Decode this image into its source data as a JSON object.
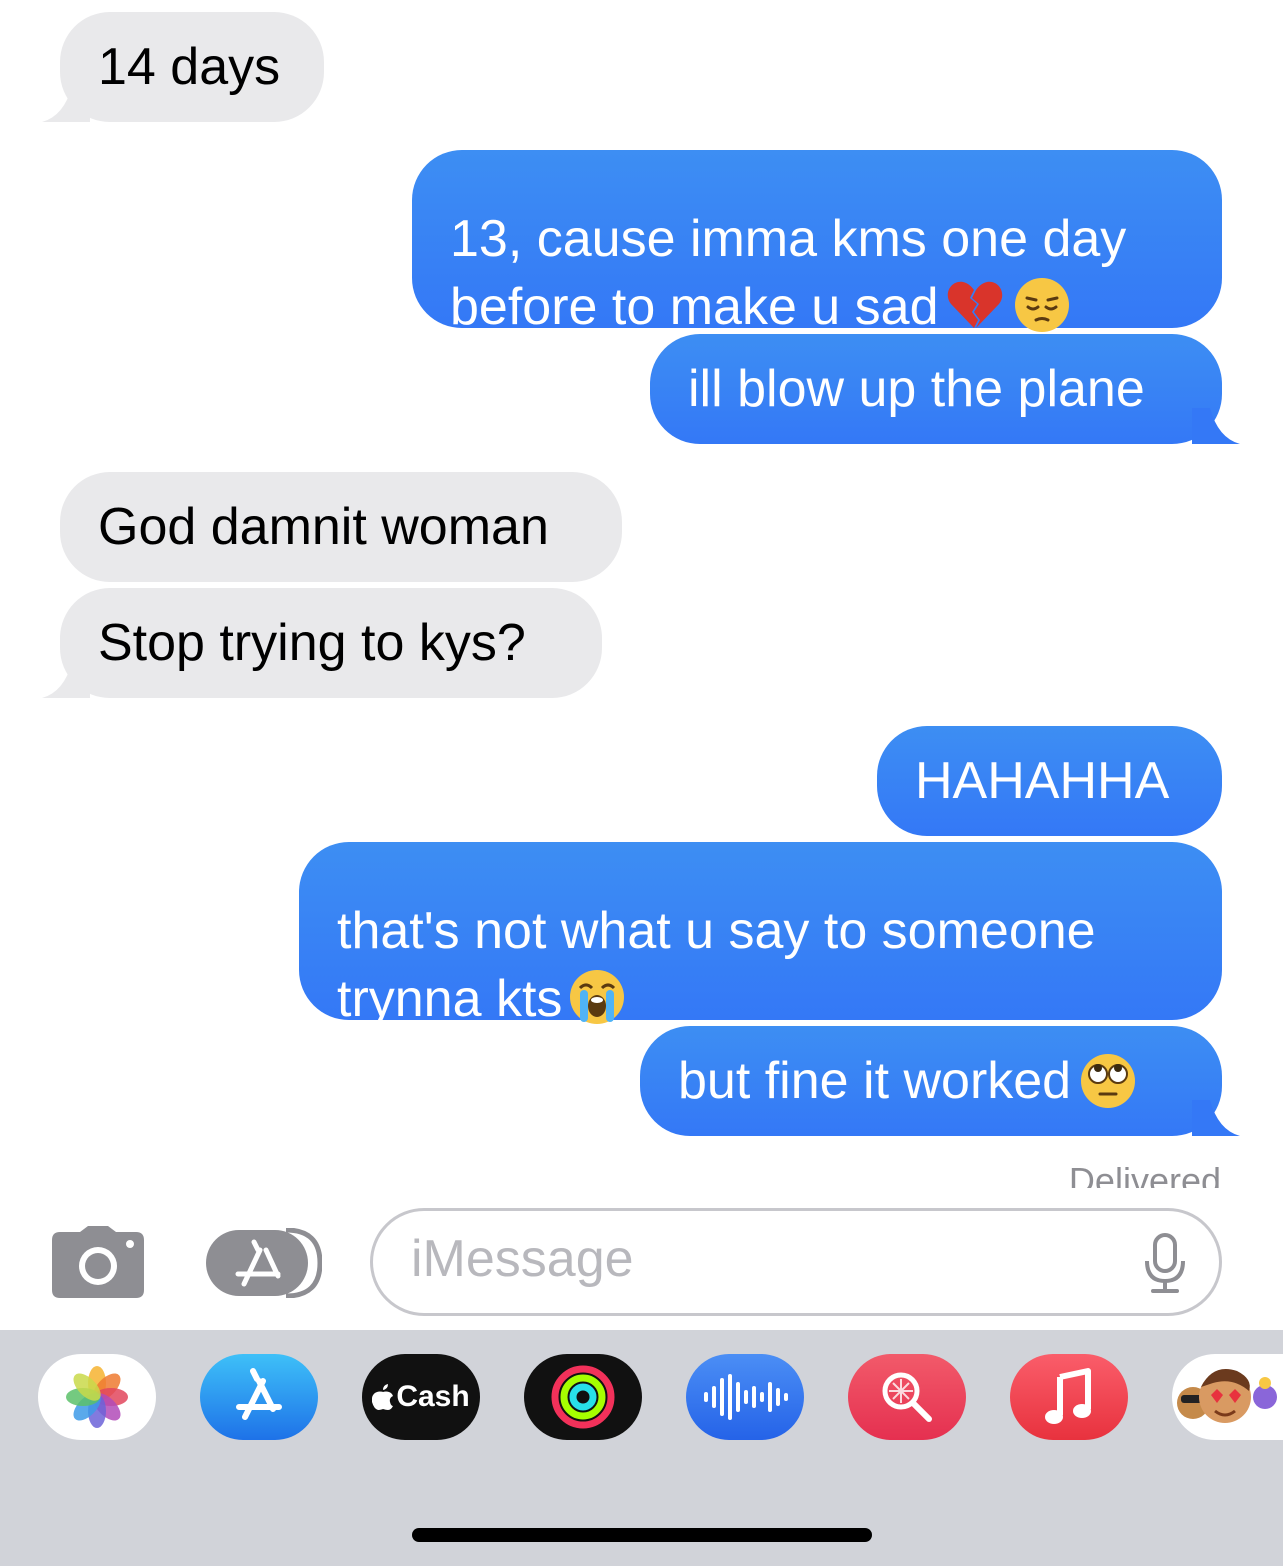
{
  "messages": [
    {
      "side": "received",
      "text": "14 days"
    },
    {
      "side": "sent",
      "text": "13, cause imma kms one day\nbefore to make u sad",
      "emoji": [
        "broken-heart",
        "pensive-face"
      ]
    },
    {
      "side": "sent",
      "text": "ill blow up the plane"
    },
    {
      "side": "received",
      "text": "God damnit woman"
    },
    {
      "side": "received",
      "text": "Stop trying to kys?"
    },
    {
      "side": "sent",
      "text": "HAHAHHA"
    },
    {
      "side": "sent",
      "text": "that's not what u say to someone\ntrynna kts",
      "emoji": [
        "loudly-crying-face"
      ]
    },
    {
      "side": "sent",
      "text": "but fine it worked",
      "emoji": [
        "face-with-rolling-eyes"
      ]
    }
  ],
  "status": "Delivered",
  "composer": {
    "placeholder": "iMessage"
  },
  "colors": {
    "sent": "#3478f6",
    "received": "#e9e9eb",
    "tray": "#d1d3d9"
  },
  "app_tray": {
    "apps": [
      {
        "name": "Photos",
        "icon": "photos-icon"
      },
      {
        "name": "App Store",
        "icon": "app-store-icon"
      },
      {
        "name": "Cash",
        "icon": "apple-cash-icon",
        "label": "Cash"
      },
      {
        "name": "Activity",
        "icon": "activity-rings-icon"
      },
      {
        "name": "Audio Message",
        "icon": "audio-waveform-icon"
      },
      {
        "name": "Images",
        "icon": "image-search-icon"
      },
      {
        "name": "Music",
        "icon": "music-note-icon"
      },
      {
        "name": "Memoji",
        "icon": "memoji-stickers-icon"
      }
    ]
  }
}
